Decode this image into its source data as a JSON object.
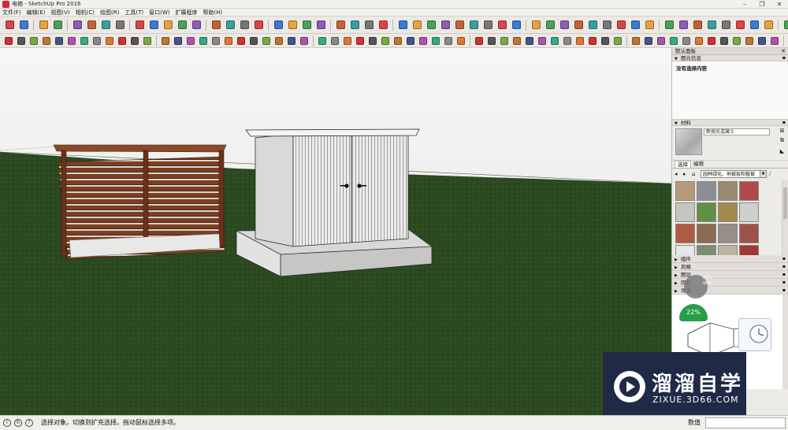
{
  "window": {
    "title": "电箱 - SketchUp Pro 2016",
    "controls": [
      "–",
      "❐",
      "✕"
    ]
  },
  "menu": [
    "文件(F)",
    "编辑(E)",
    "视图(V)",
    "相机(C)",
    "绘图(R)",
    "工具(T)",
    "窗口(W)",
    "扩展程序",
    "帮助(H)"
  ],
  "toolbar1": {
    "groups": [
      [
        "select-tool",
        "eraser-tool"
      ],
      [
        "pencil-tool",
        "line-dropdown"
      ],
      [
        "arc-tool",
        "arc-dropdown",
        "shape-tool",
        "shape-dropdown"
      ],
      [
        "push-pull-tool",
        "follow-me-tool",
        "move-tool",
        "rotate-tool",
        "scale-tool"
      ],
      [
        "tape-measure-tool",
        "text-tool",
        "axes-tool",
        "protractor-tool"
      ],
      [
        "orbit-tool",
        "pan-tool",
        "zoom-tool",
        "zoom-extents-tool"
      ],
      [
        "warehouse-icon",
        "extension-icon",
        "share-icon",
        "layout-icon"
      ],
      [
        "plugin-icon-1",
        "plugin-icon-2",
        "plugin-icon-3",
        "plugin-icon-4",
        "plugin-icon-5",
        "plugin-icon-6",
        "plugin-icon-7",
        "plugin-icon-8",
        "plugin-icon-9"
      ],
      [
        "plugin-icon-10",
        "plugin-icon-11",
        "plugin-icon-12",
        "plugin-icon-13",
        "plugin-icon-14",
        "plugin-icon-15",
        "plugin-icon-16",
        "plugin-icon-17",
        "plugin-icon-18"
      ],
      [
        "plugin-icon-19",
        "plugin-icon-20",
        "plugin-icon-21",
        "plugin-icon-22",
        "plugin-icon-23",
        "plugin-icon-24",
        "plugin-icon-25",
        "plugin-icon-26"
      ],
      [
        "plugin-icon-27",
        "plugin-icon-28",
        "plugin-icon-29"
      ]
    ],
    "active": "plugin-icon-28"
  },
  "toolbar2": {
    "count": 70
  },
  "panel": {
    "title": "默认面板",
    "entity_info": {
      "header": "图元信息",
      "content": "没有选择内容"
    },
    "materials": {
      "header": "材料",
      "current_name": "新抛光混凝土",
      "tabs": [
        "选择",
        "编辑"
      ],
      "library": "园林绿化、地被层和植被",
      "swatch_colors": [
        "#b59b7a",
        "#8c8f96",
        "#9a8a72",
        "#b04a4f",
        "#c4c7bf",
        "#5f8f45",
        "#a08a4d",
        "#cfcfcc",
        "#b05a44",
        "#8a6a52",
        "#958f88",
        "#a0524a",
        "#e7e7e7",
        "#7d8c75",
        "#bcb3a5",
        "#a03838"
      ]
    },
    "collapsed_sections": [
      "组件",
      "风格",
      "图层",
      "阴影",
      "场景"
    ]
  },
  "overlay": {
    "cpu": "22%",
    "net_up": "0K/s",
    "net_down": "0K/s"
  },
  "watermark": {
    "title": "溜溜自学",
    "url": "ZIXUE.3D66.COM"
  },
  "statusbar": {
    "message": "选择对象。切换到扩充选择。拖动鼠标选择多项。",
    "measure_label": "数值"
  },
  "colors": {
    "ground": "#2a4620",
    "sky": "#f3f3f3",
    "wood": "#7a3f22",
    "shed": "#e9e9e9",
    "active_tool": "#c9daf0"
  }
}
